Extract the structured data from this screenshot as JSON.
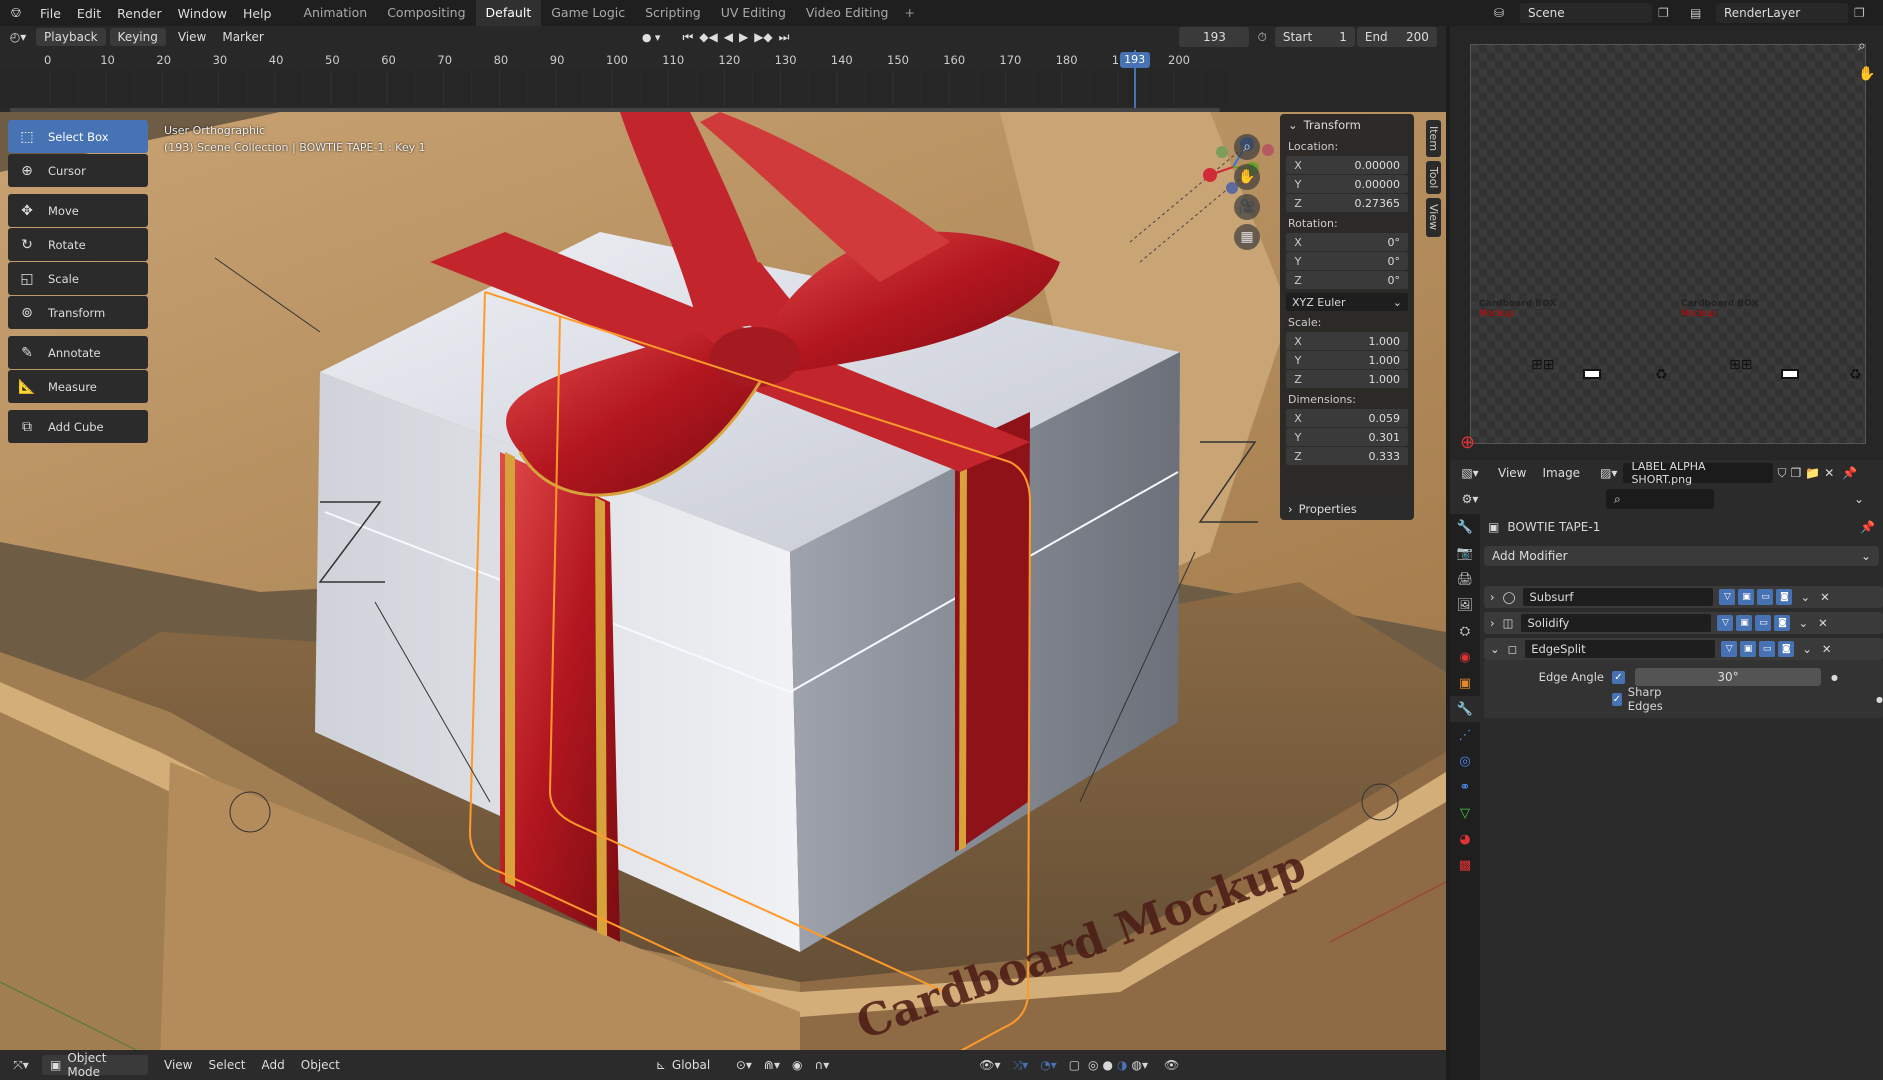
{
  "topbar": {
    "menus": [
      "File",
      "Edit",
      "Render",
      "Window",
      "Help"
    ],
    "workspaces": [
      "Animation",
      "Compositing",
      "Default",
      "Game Logic",
      "Scripting",
      "UV Editing",
      "Video Editing"
    ],
    "active_workspace": "Default",
    "scene": "Scene",
    "render_layer": "RenderLayer"
  },
  "timeline": {
    "menus": [
      "Playback",
      "Keying",
      "View",
      "Marker"
    ],
    "current_frame": "193",
    "start_label": "Start",
    "start": "1",
    "end_label": "End",
    "end": "200",
    "ticks": [
      "0",
      "10",
      "20",
      "30",
      "40",
      "50",
      "60",
      "70",
      "80",
      "90",
      "100",
      "110",
      "120",
      "130",
      "140",
      "150",
      "160",
      "170",
      "180",
      "190",
      "200"
    ],
    "playhead_frame": 193
  },
  "viewport": {
    "view_name": "User Orthographic",
    "collection_info": "(193) Scene Collection | BOWTIE TAPE-1 : Key 1",
    "tools": [
      "Select Box",
      "Cursor",
      "Move",
      "Rotate",
      "Scale",
      "Transform",
      "Annotate",
      "Measure",
      "Add Cube"
    ],
    "active_tool": "Select Box",
    "header_menus": [
      "View",
      "Select",
      "Add",
      "Object"
    ],
    "mode": "Object Mode",
    "transform_orientation": "Global",
    "box_text": "Cardboard Mockup",
    "sidebar_tabs": [
      "Item",
      "Tool",
      "View"
    ]
  },
  "transform": {
    "title": "Transform",
    "location_label": "Location:",
    "location": {
      "x": "0.00000",
      "y": "0.00000",
      "z": "0.27365"
    },
    "rotation_label": "Rotation:",
    "rotation": {
      "x": "0°",
      "y": "0°",
      "z": "0°"
    },
    "rotation_mode": "XYZ Euler",
    "scale_label": "Scale:",
    "scale": {
      "x": "1.000",
      "y": "1.000",
      "z": "1.000"
    },
    "dimensions_label": "Dimensions:",
    "dimensions": {
      "x": "0.059",
      "y": "0.301",
      "z": "0.333"
    },
    "properties_label": "Properties",
    "axes": {
      "x": "X",
      "y": "Y",
      "z": "Z"
    }
  },
  "image_editor": {
    "menus": [
      "View",
      "Image"
    ],
    "image_name": "LABEL ALPHA SHORT.png",
    "label_texts": [
      "Cardboard BOX",
      "Cardboard BOX"
    ],
    "label_subtexts": [
      "Mockup",
      "Mockup"
    ]
  },
  "properties": {
    "object_name": "BOWTIE TAPE-1",
    "add_modifier": "Add Modifier",
    "modifiers": [
      {
        "name": "Subsurf",
        "expanded": false
      },
      {
        "name": "Solidify",
        "expanded": false
      },
      {
        "name": "EdgeSplit",
        "expanded": true
      }
    ],
    "edge_angle_label": "Edge Angle",
    "edge_angle": "30°",
    "sharp_edges_label": "Sharp Edges"
  },
  "colors": {
    "accent": "#4772b3",
    "ribbon": "#b3161f",
    "ribbon_gold": "#d6a23a",
    "box_white": "#e3e6ee",
    "cardboard": "#b79163",
    "selection": "#ff9a2a"
  }
}
